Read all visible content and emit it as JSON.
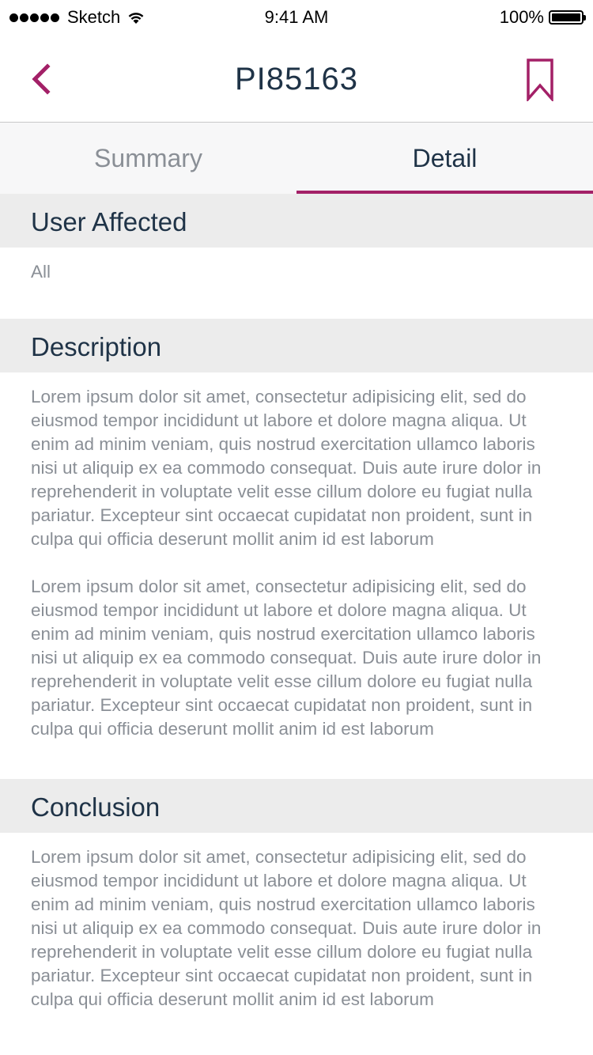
{
  "status_bar": {
    "carrier": "Sketch",
    "time": "9:41 AM",
    "battery": "100%"
  },
  "nav": {
    "title": "PI85163",
    "back_icon": "chevron-left-icon",
    "bookmark_icon": "bookmark-icon",
    "accent_color": "#a32067"
  },
  "tabs": [
    {
      "label": "Summary",
      "active": false
    },
    {
      "label": "Detail",
      "active": true
    }
  ],
  "sections": {
    "user_affected": {
      "title": "User Affected",
      "value": "All"
    },
    "description": {
      "title": "Description",
      "paragraphs": [
        "Lorem ipsum dolor sit amet, consectetur adipisicing elit, sed do eiusmod tempor incididunt ut labore et dolore magna aliqua. Ut enim ad minim veniam, quis nostrud exercitation ullamco laboris nisi ut aliquip ex ea commodo consequat. Duis aute irure dolor in reprehenderit in voluptate velit esse cillum dolore eu fugiat nulla pariatur. Excepteur sint occaecat cupidatat non proident, sunt in culpa qui officia deserunt mollit anim id est laborum",
        "Lorem ipsum dolor sit amet, consectetur adipisicing elit, sed do eiusmod tempor incididunt ut labore et dolore magna aliqua. Ut enim ad minim veniam, quis nostrud exercitation ullamco laboris nisi ut aliquip ex ea commodo consequat. Duis aute irure dolor in reprehenderit in voluptate velit esse cillum dolore eu fugiat nulla pariatur. Excepteur sint occaecat cupidatat non proident, sunt in culpa qui officia deserunt mollit anim id est laborum"
      ]
    },
    "conclusion": {
      "title": "Conclusion",
      "paragraphs": [
        "Lorem ipsum dolor sit amet, consectetur adipisicing elit, sed do eiusmod tempor incididunt ut labore et dolore magna aliqua. Ut enim ad minim veniam, quis nostrud exercitation ullamco laboris nisi ut aliquip ex ea commodo consequat. Duis aute irure dolor in reprehenderit in voluptate velit esse cillum dolore eu fugiat nulla pariatur. Excepteur sint occaecat cupidatat non proident, sunt in culpa qui officia deserunt mollit anim id est laborum"
      ]
    }
  }
}
